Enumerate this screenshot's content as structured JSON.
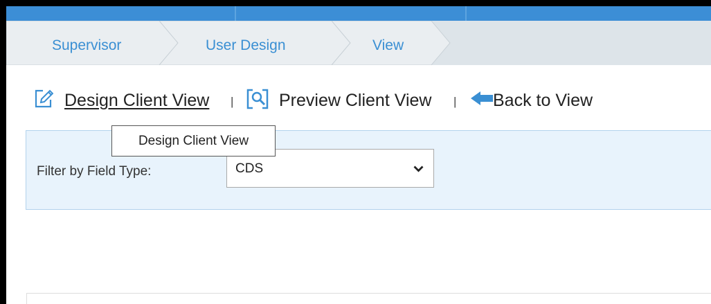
{
  "breadcrumb": {
    "items": [
      {
        "label": "Supervisor"
      },
      {
        "label": "User Design"
      },
      {
        "label": "View"
      }
    ]
  },
  "toolbar": {
    "design_label": "Design Client View",
    "preview_label": "Preview Client View",
    "back_label": "Back to View",
    "separator": "|"
  },
  "filter": {
    "label": "Filter by Field Type:",
    "selected_value": "CDS"
  },
  "tooltip": {
    "text": "Design Client View"
  },
  "colors": {
    "accent": "#3a8fd3",
    "topbar": "#3c8ed6",
    "breadcrumb_bg": "#dde4e9",
    "panel_bg": "#e8f3fc"
  },
  "icons": {
    "design": "pencil-edit-icon",
    "preview": "magnify-document-icon",
    "back": "arrow-left-icon",
    "select": "chevron-down-icon"
  }
}
